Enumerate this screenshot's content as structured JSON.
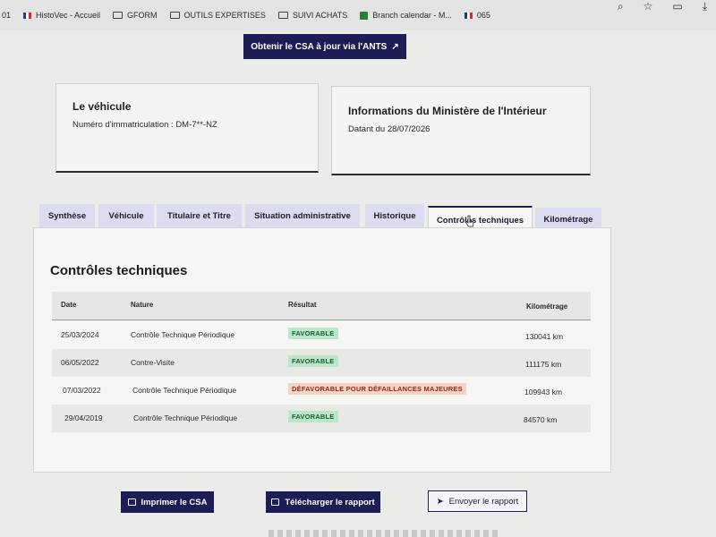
{
  "bookmarks": [
    {
      "label": "HistoVec - Accueil",
      "icon": "french-flag-icon"
    },
    {
      "label": "GFORM",
      "icon": "folder-icon"
    },
    {
      "label": "OUTILS EXPERTISES",
      "icon": "folder-icon"
    },
    {
      "label": "SUIVI ACHATS",
      "icon": "folder-icon"
    },
    {
      "label": "Branch calendar - M...",
      "icon": "calendar-icon"
    },
    {
      "label": "065",
      "icon": "french-flag-icon"
    }
  ],
  "bookmarks_prefix": "01",
  "csa_top_button": "Obtenir le CSA à jour via l'ANTS",
  "vehicle_card": {
    "title": "Le véhicule",
    "plate_label": "Numéro d'immatriculation : DM-7**-NZ"
  },
  "ministry_card": {
    "title": "Informations du Ministère de l'Intérieur",
    "date_label": "Datant du 28/07/2026"
  },
  "tabs": [
    {
      "label": "Synthèse"
    },
    {
      "label": "Véhicule"
    },
    {
      "label": "Titulaire et Titre"
    },
    {
      "label": "Situation administrative"
    },
    {
      "label": "Historique"
    },
    {
      "label": "Contrôles techniques",
      "active": true
    },
    {
      "label": "Kilométrage"
    }
  ],
  "section_title": "Contrôles techniques",
  "table": {
    "headers": [
      "Date",
      "Nature",
      "Résultat",
      "Kilométrage"
    ],
    "rows": [
      {
        "date": "25/03/2024",
        "nature": "Contrôle Technique Périodique",
        "result": "FAVORABLE",
        "status": "ok",
        "km": "130041 km"
      },
      {
        "date": "06/05/2022",
        "nature": "Contre-Visite",
        "result": "FAVORABLE",
        "status": "ok",
        "km": "111175 km"
      },
      {
        "date": "07/03/2022",
        "nature": "Contrôle Technique Périodique",
        "result": "DÉFAVORABLE POUR DÉFAILLANCES MAJEURES",
        "status": "ko",
        "km": "109943 km"
      },
      {
        "date": "29/04/2019",
        "nature": "Contrôle Technique Périodique",
        "result": "FAVORABLE",
        "status": "ok",
        "km": "84570 km"
      }
    ]
  },
  "buttons": {
    "print_csa": "Imprimer le CSA",
    "download_report": "Télécharger le rapport",
    "send_report": "Envoyer le rapport"
  },
  "colors": {
    "primary": "#1b1d54",
    "favorable_bg": "#b9e7c7",
    "defavorable_bg": "#f5d4c6"
  }
}
